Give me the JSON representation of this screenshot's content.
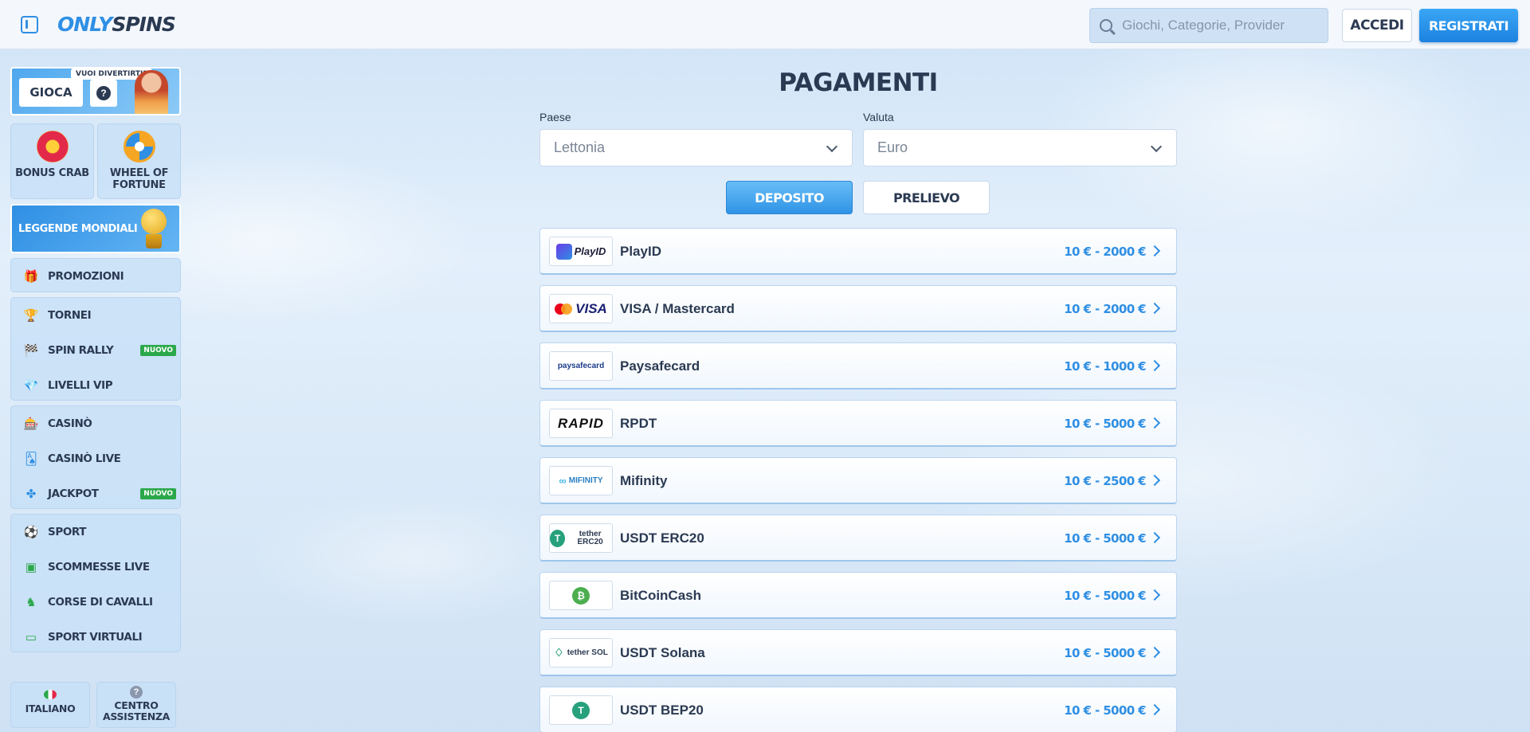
{
  "header": {
    "logo_only": "ONLY",
    "logo_spins": "SPINS",
    "search_placeholder": "Giochi, Categorie, Provider",
    "login_label": "ACCEDI",
    "register_label": "REGISTRATI"
  },
  "sidebar": {
    "promo": {
      "bubble": "VUOI DIVERTIRTI?",
      "play_label": "GIOCA",
      "help_label": "?"
    },
    "tiles": [
      {
        "label": "BONUS CRAB",
        "icon": "bonus-crab-icon"
      },
      {
        "label": "WHEEL OF FORTUNE",
        "icon": "wheel-of-fortune-icon"
      }
    ],
    "legends_label": "LEGGENDE MONDIALI",
    "nav_groups": [
      [
        {
          "label": "PROMOZIONI",
          "icon": "gift-icon",
          "glyph": "🎁"
        }
      ],
      [
        {
          "label": "TORNEI",
          "icon": "trophy-icon",
          "glyph": "🏆"
        },
        {
          "label": "SPIN RALLY",
          "icon": "flag-icon",
          "glyph": "🏁",
          "badge": "NUOVO"
        },
        {
          "label": "LIVELLI VIP",
          "icon": "diamond-icon",
          "glyph": "💎"
        }
      ],
      [
        {
          "label": "CASINÒ",
          "icon": "slot-machine-icon",
          "glyph": "🎰"
        },
        {
          "label": "CASINÒ LIVE",
          "icon": "cards-icon",
          "glyph": "🂡"
        },
        {
          "label": "JACKPOT",
          "icon": "clover-icon",
          "glyph": "✤",
          "badge": "NUOVO"
        }
      ],
      [
        {
          "label": "SPORT",
          "icon": "soccer-ball-icon",
          "glyph": "⚽"
        },
        {
          "label": "SCOMMESSE LIVE",
          "icon": "live-icon",
          "glyph": "▣"
        },
        {
          "label": "CORSE DI CAVALLI",
          "icon": "horse-icon",
          "glyph": "♞"
        },
        {
          "label": "SPORT VIRTUALI",
          "icon": "monitor-icon",
          "glyph": "▭"
        }
      ]
    ],
    "bottom": {
      "language_label": "ITALIANO",
      "help_center_label": "CENTRO ASSISTENZA",
      "help_glyph": "?"
    }
  },
  "main": {
    "title": "PAGAMENTI",
    "country_label": "Paese",
    "country_value": "Lettonia",
    "currency_label": "Valuta",
    "currency_value": "Euro",
    "tabs": {
      "deposit": "DEPOSITO",
      "withdraw": "PRELIEVO",
      "active": "deposit"
    },
    "methods": [
      {
        "name": "PlayID",
        "range": "10 € - 2000 €",
        "logo_text": "PlayID"
      },
      {
        "name": "VISA / Mastercard",
        "range": "10 € - 2000 €",
        "logo_text": "VISA"
      },
      {
        "name": "Paysafecard",
        "range": "10 € - 1000 €",
        "logo_text": "paysafecard"
      },
      {
        "name": "RPDT",
        "range": "10 € - 5000 €",
        "logo_text": "RAPID"
      },
      {
        "name": "Mifinity",
        "range": "10 € - 2500 €",
        "logo_text": "MIFINITY"
      },
      {
        "name": "USDT ERC20",
        "range": "10 € - 5000 €",
        "logo_text": "tether ERC20"
      },
      {
        "name": "BitCoinCash",
        "range": "10 € - 5000 €",
        "logo_text": "₿"
      },
      {
        "name": "USDT Solana",
        "range": "10 € - 5000 €",
        "logo_text": "tether SOL"
      },
      {
        "name": "USDT BEP20",
        "range": "10 € - 5000 €",
        "logo_text": "T"
      }
    ],
    "colors": {
      "accent": "#2f8fe4",
      "text": "#2b3a52",
      "badge_green": "#2ba84a"
    }
  }
}
